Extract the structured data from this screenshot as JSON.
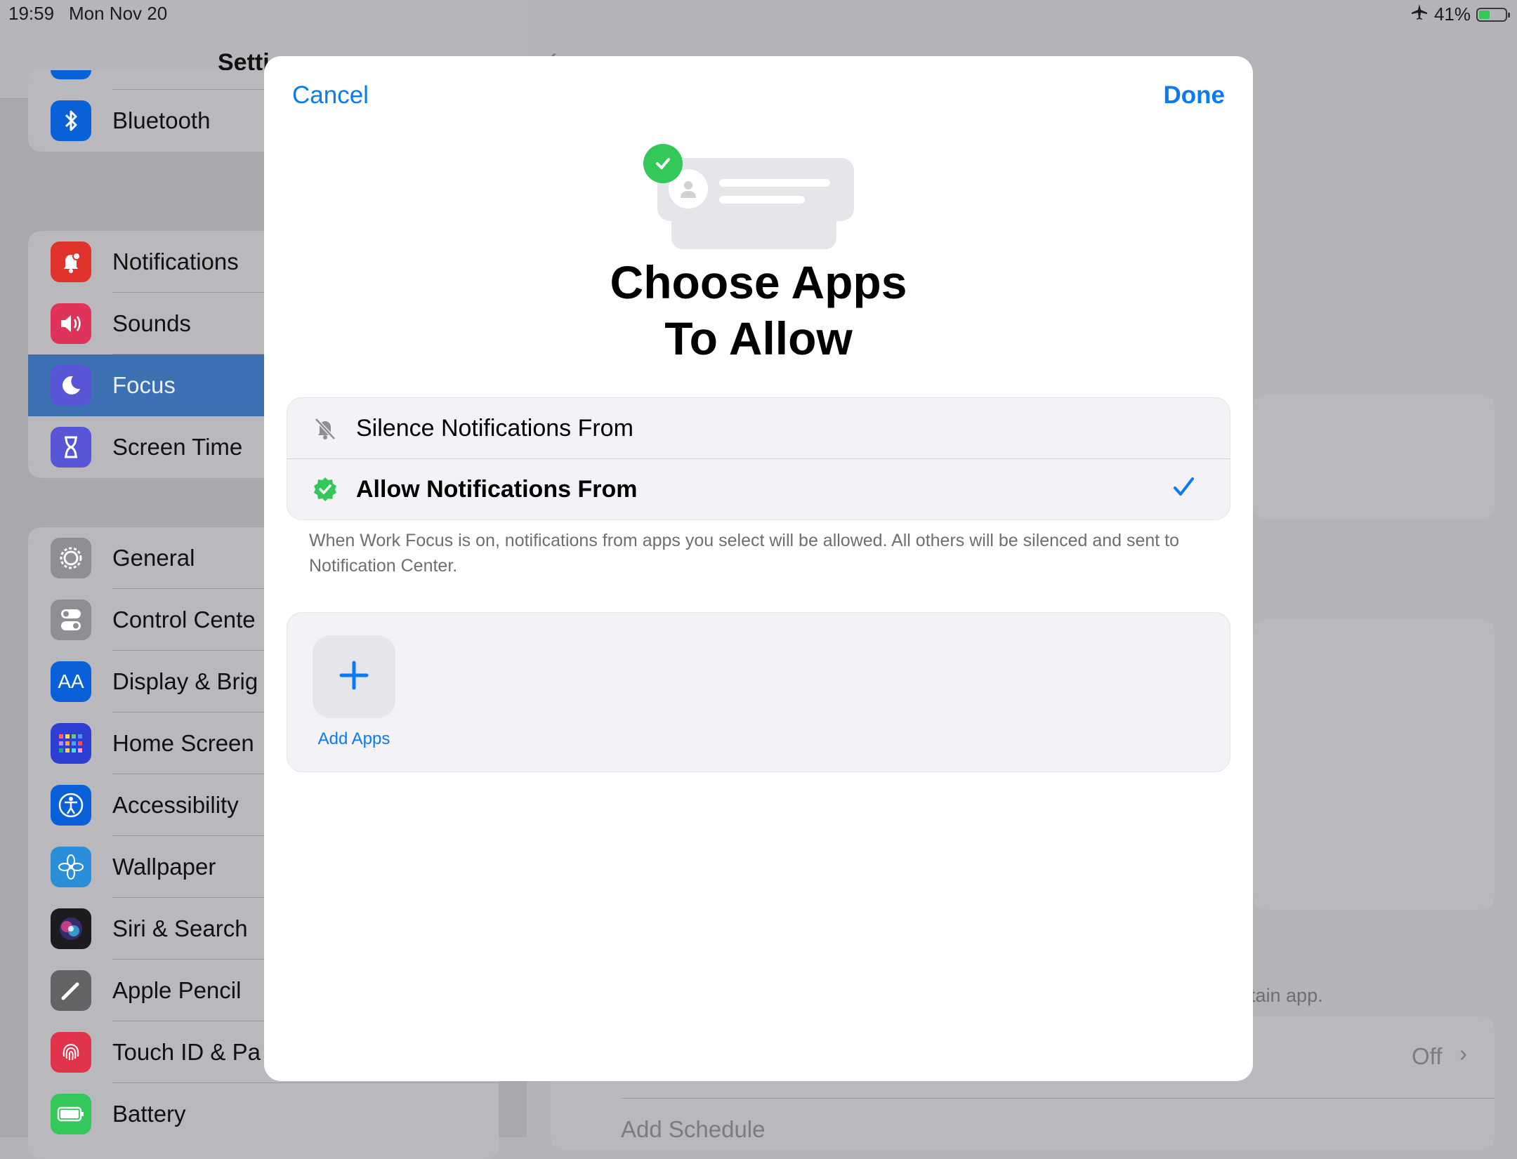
{
  "status_bar": {
    "time": "19:59",
    "date": "Mon Nov 20",
    "battery_percent": "41%",
    "battery_level": 0.41,
    "airplane_icon": "airplane-icon"
  },
  "sidebar": {
    "title": "Setti",
    "groups": [
      {
        "items": [
          {
            "label": "Bluetooth",
            "icon": "bluetooth-icon",
            "color": "#0a60d6"
          }
        ]
      },
      {
        "items": [
          {
            "label": "Notifications",
            "icon": "bell-icon",
            "color": "#e0332c"
          },
          {
            "label": "Sounds",
            "icon": "speaker-icon",
            "color": "#e0335a"
          },
          {
            "label": "Focus",
            "icon": "moon-icon",
            "color": "#5856d6",
            "selected": true
          },
          {
            "label": "Screen Time",
            "icon": "hourglass-icon",
            "color": "#5856d6"
          }
        ]
      },
      {
        "items": [
          {
            "label": "General",
            "icon": "gear-icon",
            "color": "#8e8e93"
          },
          {
            "label": "Control Cente",
            "icon": "toggles-icon",
            "color": "#8e8e93"
          },
          {
            "label": "Display & Brig",
            "icon": "text-size-icon",
            "color": "#0a60d6"
          },
          {
            "label": "Home Screen",
            "icon": "grid-icon",
            "color": "#2c3fd0"
          },
          {
            "label": "Accessibility",
            "icon": "accessibility-icon",
            "color": "#0a60d6"
          },
          {
            "label": "Wallpaper",
            "icon": "flower-icon",
            "color": "#2a8fd8"
          },
          {
            "label": "Siri & Search",
            "icon": "siri-icon",
            "color": "#1c1c1e"
          },
          {
            "label": "Apple Pencil",
            "icon": "pencil-icon",
            "color": "#636366"
          },
          {
            "label": "Touch ID & Pa",
            "icon": "fingerprint-icon",
            "color": "#e0334c"
          },
          {
            "label": "Battery",
            "icon": "battery-icon",
            "color": "#34c759"
          }
        ]
      }
    ]
  },
  "detail": {
    "hint_text": "tain app.",
    "off_label": "Off",
    "add_schedule": "Add Schedule"
  },
  "sheet": {
    "cancel_label": "Cancel",
    "done_label": "Done",
    "title_line1": "Choose Apps",
    "title_line2": "To Allow",
    "options": [
      {
        "label": "Silence Notifications From",
        "icon": "bell-slash-icon",
        "selected": false
      },
      {
        "label": "Allow Notifications From",
        "icon": "verified-check-icon",
        "selected": true
      }
    ],
    "footnote": "When Work Focus is on, notifications from apps you select will be allowed. All others will be silenced and sent to Notification Center.",
    "add_apps_label": "Add Apps"
  },
  "colors": {
    "accent": "#0a7bf7",
    "green": "#34c759"
  }
}
